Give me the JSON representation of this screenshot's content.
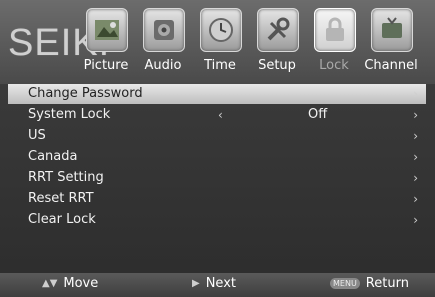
{
  "brand": "SEIKI",
  "tabs": [
    {
      "label": "Picture",
      "icon": "picture-icon"
    },
    {
      "label": "Audio",
      "icon": "audio-icon"
    },
    {
      "label": "Time",
      "icon": "time-icon"
    },
    {
      "label": "Setup",
      "icon": "setup-icon"
    },
    {
      "label": "Lock",
      "icon": "lock-icon"
    },
    {
      "label": "Channel",
      "icon": "channel-icon"
    }
  ],
  "menu": {
    "items": [
      {
        "label": "Change Password",
        "value": "",
        "has_left_arrow": false,
        "arrow": "›"
      },
      {
        "label": "System Lock",
        "value": "Off",
        "has_left_arrow": true,
        "arrow": "›"
      },
      {
        "label": "US",
        "value": "",
        "has_left_arrow": false,
        "arrow": "›"
      },
      {
        "label": "Canada",
        "value": "",
        "has_left_arrow": false,
        "arrow": "›"
      },
      {
        "label": "RRT Setting",
        "value": "",
        "has_left_arrow": false,
        "arrow": "›"
      },
      {
        "label": "Reset RRT",
        "value": "",
        "has_left_arrow": false,
        "arrow": "›"
      },
      {
        "label": "Clear Lock",
        "value": "",
        "has_left_arrow": false,
        "arrow": "›"
      }
    ],
    "left_arrow": "‹"
  },
  "footer": {
    "move_label": "Move",
    "next_label": "Next",
    "menu_key": "MENU",
    "return_label": "Return"
  }
}
